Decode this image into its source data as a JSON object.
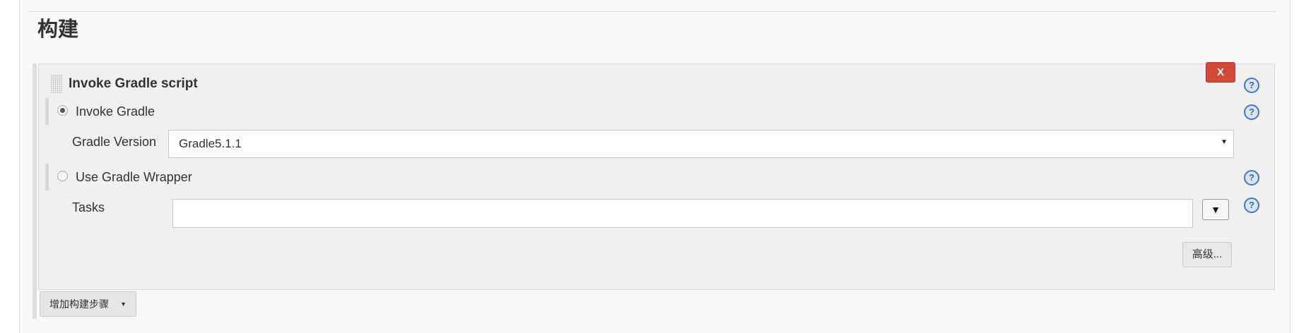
{
  "section": {
    "title": "构建"
  },
  "build_step": {
    "title": "Invoke Gradle script",
    "delete_label": "X",
    "help_glyph": "?",
    "options": {
      "invoke_gradle": {
        "label": "Invoke Gradle",
        "selected": true
      },
      "gradle_version": {
        "label": "Gradle Version",
        "value": "Gradle5.1.1"
      },
      "use_wrapper": {
        "label": "Use Gradle Wrapper",
        "selected": false
      }
    },
    "tasks": {
      "label": "Tasks",
      "value": "",
      "expand_glyph": "▼"
    },
    "advanced_label": "高级..."
  },
  "add_step": {
    "label": "增加构建步骤",
    "caret": "▼"
  },
  "colors": {
    "delete": "#d24939",
    "help": "#4a78b4",
    "panel": "#f8f8f8",
    "step_bg": "#f0f0f0"
  },
  "icons": [
    "drag-handle-icon",
    "help-icon",
    "dropdown-caret-icon",
    "expand-icon"
  ]
}
